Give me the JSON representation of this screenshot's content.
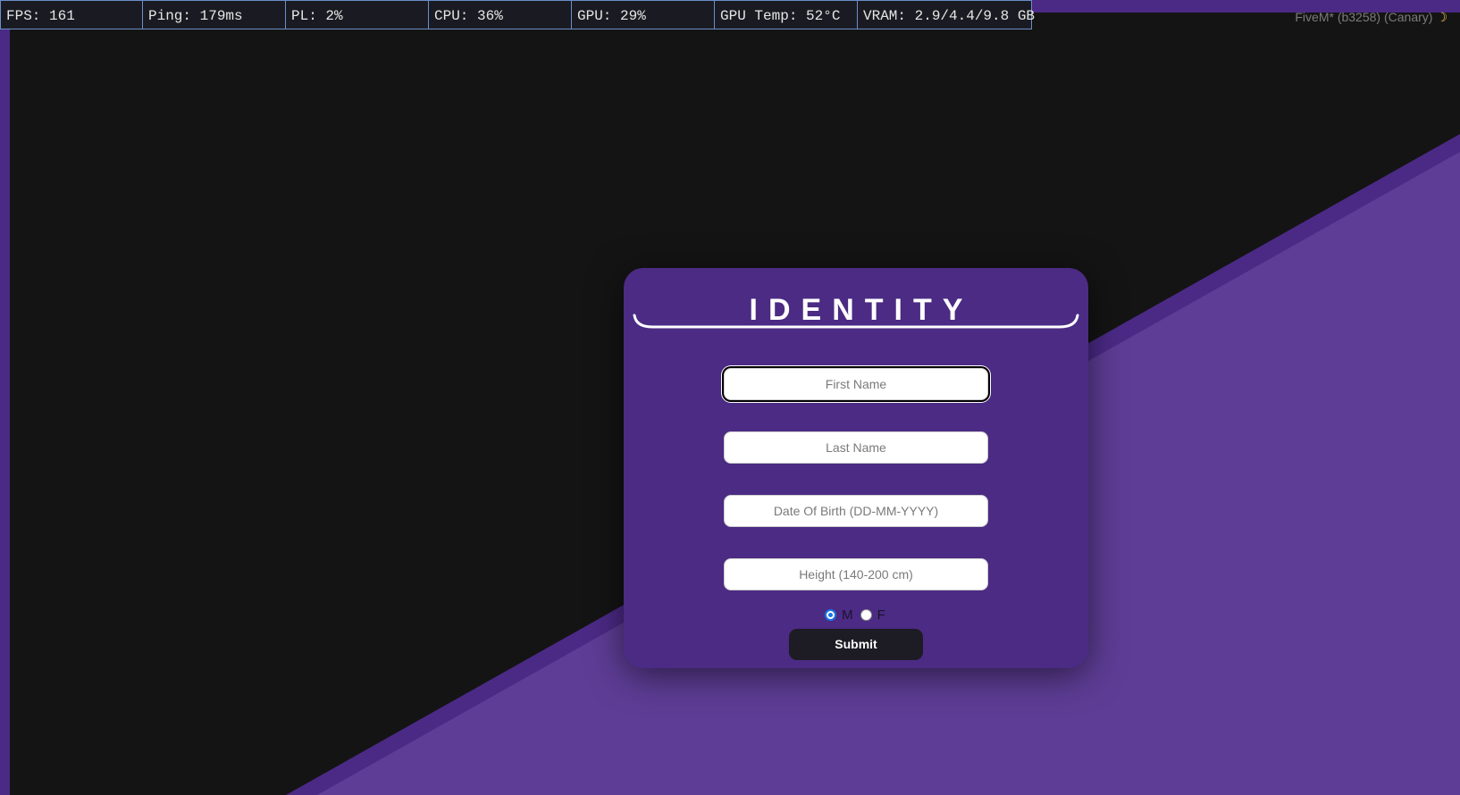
{
  "overlay": {
    "fps": "FPS: 161",
    "ping": "Ping: 179ms",
    "packet_loss": "PL: 2%",
    "cpu": "CPU: 36%",
    "gpu": "GPU: 29%",
    "gpu_temp": "GPU Temp: 52°C",
    "vram": "VRAM: 2.9/4.4/9.8 GB"
  },
  "app": {
    "build_label": "FiveM* (b3258) (Canary)",
    "moon_icon": "☽"
  },
  "form": {
    "title": "IDENTITY",
    "first_name_placeholder": "First Name",
    "last_name_placeholder": "Last Name",
    "dob_placeholder": "Date Of Birth (DD-MM-YYYY)",
    "height_placeholder": "Height (140-200 cm)",
    "gender_options": [
      "M",
      "F"
    ],
    "gender_selected": "M",
    "submit_label": "Submit"
  },
  "colors": {
    "panel": "#4b2b83",
    "diagonal_light": "#5e3d96",
    "diagonal_dark": "#4b2a86",
    "background": "#141414",
    "button": "#1d1b24"
  }
}
